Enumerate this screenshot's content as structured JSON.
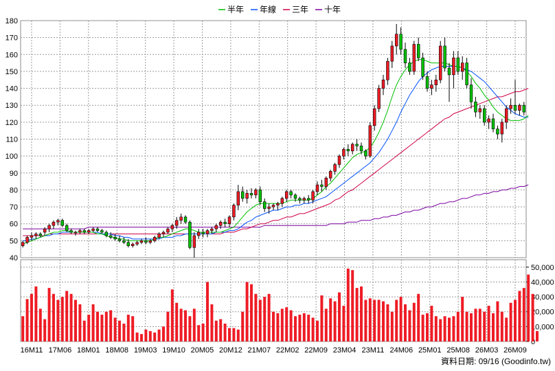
{
  "chart_data": {
    "type": "candlestick",
    "legend": [
      {
        "label": "半年",
        "color": "#00c000"
      },
      {
        "label": "年線",
        "color": "#0050ff"
      },
      {
        "label": "三年",
        "color": "#d0004a"
      },
      {
        "label": "十年",
        "color": "#7a00a0"
      }
    ],
    "price_axis": {
      "min": 40,
      "max": 180,
      "ticks": [
        "40",
        "50",
        "60",
        "70",
        "80",
        "90",
        "100",
        "110",
        "120",
        "130",
        "140",
        "150",
        "160",
        "170",
        "180"
      ]
    },
    "volume_axis": {
      "min": 0,
      "max": 55000,
      "ticks": [
        "0",
        "10,000",
        "20,000",
        "30,000",
        "40,000",
        "50,000"
      ]
    },
    "x_labels": [
      "16M11",
      "17M06",
      "18M01",
      "18M08",
      "19M03",
      "19M10",
      "20M05",
      "20M12",
      "21M07",
      "22M02",
      "22M09",
      "23M04",
      "23M11",
      "24M06",
      "25M01",
      "25M08",
      "26M03",
      "26M09"
    ],
    "candles": [
      [
        47,
        50,
        46,
        49
      ],
      [
        49,
        53,
        48,
        52
      ],
      [
        52,
        55,
        50,
        53
      ],
      [
        53,
        55,
        51,
        54
      ],
      [
        54,
        55,
        52,
        53
      ],
      [
        55,
        58,
        53,
        57
      ],
      [
        57,
        60,
        55,
        59
      ],
      [
        59,
        62,
        57,
        61
      ],
      [
        61,
        63,
        59,
        62
      ],
      [
        62,
        63,
        58,
        59
      ],
      [
        59,
        60,
        55,
        56
      ],
      [
        56,
        57,
        54,
        55
      ],
      [
        55,
        56,
        53,
        55
      ],
      [
        55,
        57,
        54,
        56
      ],
      [
        56,
        57,
        54,
        55
      ],
      [
        55,
        57,
        54,
        56
      ],
      [
        56,
        58,
        55,
        57
      ],
      [
        57,
        58,
        55,
        56
      ],
      [
        56,
        57,
        54,
        55
      ],
      [
        55,
        56,
        52,
        53
      ],
      [
        53,
        55,
        51,
        52
      ],
      [
        52,
        54,
        50,
        51
      ],
      [
        51,
        53,
        49,
        50
      ],
      [
        50,
        52,
        48,
        49
      ],
      [
        49,
        51,
        46,
        47
      ],
      [
        47,
        49,
        46,
        48
      ],
      [
        48,
        50,
        47,
        49
      ],
      [
        49,
        51,
        48,
        50
      ],
      [
        50,
        52,
        48,
        49
      ],
      [
        49,
        51,
        48,
        50
      ],
      [
        50,
        53,
        49,
        52
      ],
      [
        52,
        55,
        51,
        54
      ],
      [
        54,
        56,
        52,
        55
      ],
      [
        55,
        58,
        54,
        57
      ],
      [
        57,
        60,
        55,
        59
      ],
      [
        59,
        64,
        57,
        62
      ],
      [
        62,
        66,
        60,
        64
      ],
      [
        64,
        65,
        60,
        61
      ],
      [
        61,
        62,
        45,
        46
      ],
      [
        46,
        55,
        40,
        53
      ],
      [
        53,
        57,
        51,
        55
      ],
      [
        55,
        57,
        52,
        54
      ],
      [
        54,
        57,
        52,
        56
      ],
      [
        56,
        58,
        54,
        57
      ],
      [
        57,
        60,
        55,
        59
      ],
      [
        59,
        62,
        57,
        61
      ],
      [
        61,
        63,
        58,
        60
      ],
      [
        60,
        65,
        58,
        64
      ],
      [
        64,
        72,
        62,
        71
      ],
      [
        71,
        83,
        68,
        79
      ],
      [
        79,
        82,
        73,
        75
      ],
      [
        75,
        80,
        72,
        78
      ],
      [
        78,
        81,
        75,
        77
      ],
      [
        77,
        81,
        75,
        80
      ],
      [
        80,
        82,
        71,
        73
      ],
      [
        73,
        75,
        67,
        69
      ],
      [
        69,
        72,
        66,
        70
      ],
      [
        70,
        72,
        68,
        71
      ],
      [
        71,
        73,
        68,
        72
      ],
      [
        72,
        76,
        70,
        75
      ],
      [
        75,
        80,
        73,
        79
      ],
      [
        79,
        80,
        75,
        77
      ],
      [
        77,
        78,
        73,
        75
      ],
      [
        75,
        76,
        72,
        74
      ],
      [
        74,
        76,
        72,
        75
      ],
      [
        75,
        77,
        72,
        74
      ],
      [
        74,
        80,
        72,
        79
      ],
      [
        79,
        85,
        77,
        83
      ],
      [
        83,
        86,
        79,
        82
      ],
      [
        82,
        88,
        80,
        87
      ],
      [
        87,
        92,
        85,
        91
      ],
      [
        91,
        96,
        89,
        95
      ],
      [
        95,
        101,
        93,
        100
      ],
      [
        100,
        105,
        98,
        104
      ],
      [
        104,
        107,
        100,
        103
      ],
      [
        103,
        108,
        101,
        107
      ],
      [
        107,
        110,
        103,
        106
      ],
      [
        106,
        108,
        101,
        103
      ],
      [
        103,
        104,
        98,
        100
      ],
      [
        100,
        120,
        99,
        118
      ],
      [
        118,
        130,
        115,
        128
      ],
      [
        128,
        142,
        126,
        140
      ],
      [
        140,
        148,
        136,
        145
      ],
      [
        145,
        158,
        142,
        156
      ],
      [
        156,
        168,
        152,
        165
      ],
      [
        165,
        178,
        160,
        172
      ],
      [
        172,
        176,
        160,
        163
      ],
      [
        163,
        167,
        152,
        155
      ],
      [
        155,
        158,
        148,
        150
      ],
      [
        150,
        168,
        148,
        166
      ],
      [
        166,
        170,
        156,
        158
      ],
      [
        158,
        161,
        145,
        147
      ],
      [
        147,
        150,
        138,
        140
      ],
      [
        140,
        145,
        136,
        142
      ],
      [
        142,
        148,
        138,
        145
      ],
      [
        145,
        168,
        143,
        165
      ],
      [
        165,
        170,
        150,
        152
      ],
      [
        152,
        155,
        132,
        148
      ],
      [
        148,
        162,
        140,
        158
      ],
      [
        158,
        162,
        148,
        150
      ],
      [
        150,
        159,
        145,
        155
      ],
      [
        155,
        158,
        140,
        142
      ],
      [
        142,
        146,
        128,
        132
      ],
      [
        132,
        135,
        123,
        126
      ],
      [
        126,
        130,
        122,
        128
      ],
      [
        128,
        130,
        118,
        120
      ],
      [
        120,
        124,
        116,
        122
      ],
      [
        122,
        125,
        114,
        116
      ],
      [
        116,
        118,
        110,
        113
      ],
      [
        113,
        122,
        108,
        120
      ],
      [
        120,
        130,
        116,
        128
      ],
      [
        128,
        134,
        125,
        130
      ],
      [
        130,
        145,
        125,
        127
      ],
      [
        127,
        131,
        124,
        130
      ],
      [
        130,
        132,
        124,
        126
      ]
    ],
    "volumes": [
      17000,
      28500,
      32000,
      37000,
      22000,
      15000,
      36000,
      32000,
      28000,
      30000,
      34000,
      32000,
      28000,
      25000,
      14000,
      18000,
      25000,
      20000,
      18000,
      20000,
      21000,
      16000,
      14000,
      12000,
      18000,
      17000,
      6000,
      5000,
      8000,
      7000,
      6000,
      8000,
      10000,
      20000,
      35000,
      26000,
      22000,
      21000,
      17000,
      22000,
      11000,
      12000,
      40000,
      25000,
      14000,
      15000,
      12000,
      9000,
      9000,
      8000,
      20000,
      40000,
      38500,
      32000,
      28000,
      30000,
      32000,
      20000,
      19000,
      22000,
      23000,
      21000,
      17000,
      18000,
      19000,
      18000,
      16000,
      14000,
      31000,
      22000,
      29000,
      27000,
      33000,
      24000,
      49000,
      48000,
      36000,
      37000,
      28000,
      29000,
      28000,
      28000,
      27000,
      25000,
      20000,
      28000,
      30000,
      25000,
      21000,
      26000,
      32000,
      18000,
      19000,
      24000,
      17000,
      15000,
      17000,
      16000,
      17000,
      20000,
      30000,
      20000,
      19000,
      22000,
      22000,
      20000,
      24000,
      19000,
      27000,
      20000,
      16000,
      26000,
      28000,
      34000,
      36000,
      45000,
      32000,
      7000
    ],
    "ma_half": [
      48,
      49,
      50,
      51,
      52,
      53,
      54,
      55,
      55,
      56,
      56,
      55,
      55,
      55,
      55,
      55,
      55,
      54,
      54,
      53,
      52,
      52,
      51,
      51,
      50,
      50,
      50,
      50,
      50,
      50,
      51,
      52,
      52,
      53,
      54,
      55,
      56,
      57,
      57,
      56,
      55,
      55,
      55,
      55,
      55,
      55,
      56,
      57,
      58,
      61,
      64,
      67,
      69,
      71,
      72,
      72,
      72,
      72,
      72,
      72,
      73,
      74,
      74,
      74,
      74,
      74,
      75,
      77,
      79,
      82,
      84,
      87,
      90,
      93,
      96,
      99,
      101,
      102,
      103,
      105,
      109,
      114,
      120,
      127,
      135,
      142,
      147,
      151,
      154,
      156,
      157,
      157,
      156,
      155,
      155,
      155,
      155,
      154,
      153,
      153,
      152,
      150,
      147,
      143,
      140,
      136,
      133,
      129,
      126,
      124,
      122,
      121,
      121,
      121,
      122,
      124
    ],
    "ma_year": [
      50,
      50,
      51,
      51,
      52,
      53,
      53,
      54,
      54,
      55,
      55,
      55,
      55,
      55,
      55,
      55,
      55,
      55,
      54,
      54,
      54,
      53,
      53,
      52,
      52,
      51,
      51,
      51,
      51,
      51,
      51,
      51,
      52,
      52,
      52,
      53,
      53,
      54,
      54,
      54,
      54,
      54,
      54,
      54,
      55,
      55,
      55,
      56,
      56,
      57,
      59,
      61,
      62,
      64,
      65,
      66,
      67,
      68,
      68,
      69,
      70,
      70,
      71,
      71,
      72,
      72,
      73,
      74,
      75,
      76,
      78,
      80,
      82,
      84,
      86,
      88,
      90,
      92,
      94,
      96,
      99,
      102,
      106,
      110,
      115,
      120,
      126,
      131,
      136,
      140,
      144,
      147,
      149,
      151,
      152,
      153,
      153,
      153,
      153,
      153,
      152,
      151,
      150,
      148,
      146,
      144,
      141,
      138,
      135,
      132,
      129,
      127,
      125,
      124,
      123,
      123
    ],
    "ma_3y": [
      53,
      53,
      53,
      53,
      53,
      53,
      54,
      54,
      54,
      54,
      54,
      54,
      54,
      54,
      54,
      54,
      54,
      54,
      54,
      54,
      54,
      54,
      54,
      54,
      54,
      54,
      54,
      54,
      54,
      54,
      54,
      54,
      54,
      54,
      54,
      54,
      54,
      54,
      54,
      54,
      54,
      54,
      54,
      54,
      54,
      54,
      55,
      55,
      55,
      56,
      57,
      57,
      58,
      59,
      60,
      60,
      61,
      62,
      62,
      63,
      64,
      64,
      65,
      66,
      66,
      67,
      68,
      69,
      70,
      71,
      72,
      74,
      75,
      77,
      79,
      80,
      82,
      84,
      86,
      88,
      90,
      92,
      94,
      96,
      98,
      100,
      102,
      104,
      106,
      108,
      110,
      112,
      114,
      116,
      118,
      120,
      122,
      123,
      125,
      126,
      127,
      128,
      129,
      130,
      131,
      132,
      133,
      134,
      135,
      135,
      136,
      137,
      138,
      138,
      139,
      140
    ],
    "ma_10y": [
      57,
      57,
      57,
      57,
      57,
      57,
      57,
      57,
      57,
      57,
      57,
      57,
      57,
      57,
      57,
      58,
      58,
      58,
      58,
      58,
      58,
      58,
      58,
      58,
      58,
      58,
      58,
      58,
      58,
      58,
      58,
      58,
      58,
      58,
      58,
      58,
      58,
      58,
      58,
      58,
      58,
      58,
      58,
      58,
      58,
      58,
      58,
      58,
      58,
      58,
      58,
      58,
      58,
      58,
      58,
      59,
      59,
      59,
      59,
      59,
      59,
      59,
      59,
      59,
      59,
      59,
      59,
      59,
      59,
      59,
      60,
      60,
      60,
      60,
      61,
      61,
      61,
      62,
      62,
      62,
      63,
      63,
      64,
      64,
      65,
      65,
      66,
      67,
      67,
      68,
      68,
      69,
      70,
      70,
      71,
      72,
      72,
      73,
      73,
      74,
      75,
      75,
      76,
      77,
      77,
      78,
      78,
      79,
      79,
      80,
      80,
      81,
      81,
      82,
      82,
      83
    ]
  },
  "watermark": "資料日期: 09/16  (Goodinfo.tw)"
}
